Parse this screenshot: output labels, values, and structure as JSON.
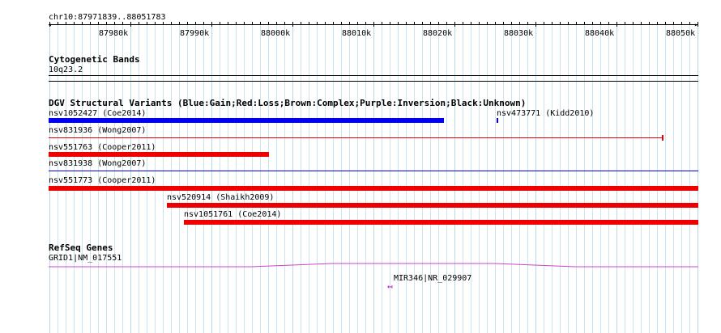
{
  "region": "chr10:87971839..88051783",
  "ruler": {
    "labels": [
      "87980k",
      "87990k",
      "88000k",
      "88010k",
      "88020k",
      "88030k",
      "88040k",
      "88050k"
    ]
  },
  "tracks": {
    "cytoband": {
      "title": "Cytogenetic Bands",
      "band": "10q23.2"
    },
    "dgv": {
      "title": "DGV Structural Variants (Blue:Gain;Red:Loss;Brown:Complex;Purple:Inversion;Black:Unknown)",
      "features": [
        {
          "label": "nsv1052427 (Coe2014)",
          "type": "Gain",
          "color": "#0000ee"
        },
        {
          "label": "nsv473771 (Kidd2010)",
          "type": "Gain",
          "color": "#0000ee"
        },
        {
          "label": "nsv831936 (Wong2007)",
          "type": "Loss",
          "color": "#ee0000"
        },
        {
          "label": "nsv551763 (Cooper2011)",
          "type": "Loss",
          "color": "#ee0000"
        },
        {
          "label": "nsv831938 (Wong2007)",
          "type": "Gain",
          "color": "#0000ee"
        },
        {
          "label": "nsv551773 (Cooper2011)",
          "type": "Loss",
          "color": "#ee0000"
        },
        {
          "label": "nsv520914 (Shaikh2009)",
          "type": "Loss",
          "color": "#ee0000"
        },
        {
          "label": "nsv1051761 (Coe2014)",
          "type": "Loss",
          "color": "#ee0000"
        }
      ]
    },
    "refseq": {
      "title": "RefSeq Genes",
      "genes": [
        {
          "label": "GRID1|NM_017551",
          "color": "#cc44cc"
        },
        {
          "label": "MIR346|NR_029907",
          "color": "#cc00cc"
        }
      ]
    }
  }
}
